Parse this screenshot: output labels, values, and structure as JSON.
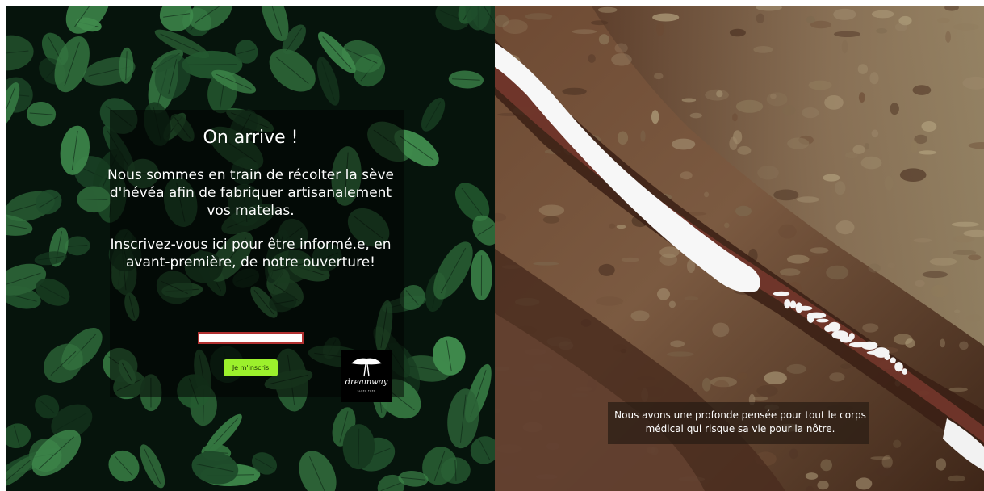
{
  "left": {
    "headline": "On arrive !",
    "paragraph_1": "Nous sommes en train de récolter la sève d'hévéa afin de fabriquer artisanalement vos matelas.",
    "paragraph_2": "Inscrivez-vous ici pour être informé.e, en avant-première, de notre ouverture!",
    "email_input": {
      "value": "",
      "placeholder": ""
    },
    "subscribe_label": "Je m'inscris",
    "logo": {
      "name": "dreamway",
      "tagline": "SLEEP FREE",
      "icon": "acacia-tree-icon"
    }
  },
  "right": {
    "caption": "Nous avons une profonde pensée pour tout le corps médical qui risque sa vie pour la nôtre."
  },
  "colors": {
    "button": "#9cf02c",
    "input_border": "#b03030",
    "leaf_dark": "#07160d",
    "leaf_green": "#2e6a3a",
    "bark": "#5b3a25",
    "latex": "#f4f4f4"
  }
}
